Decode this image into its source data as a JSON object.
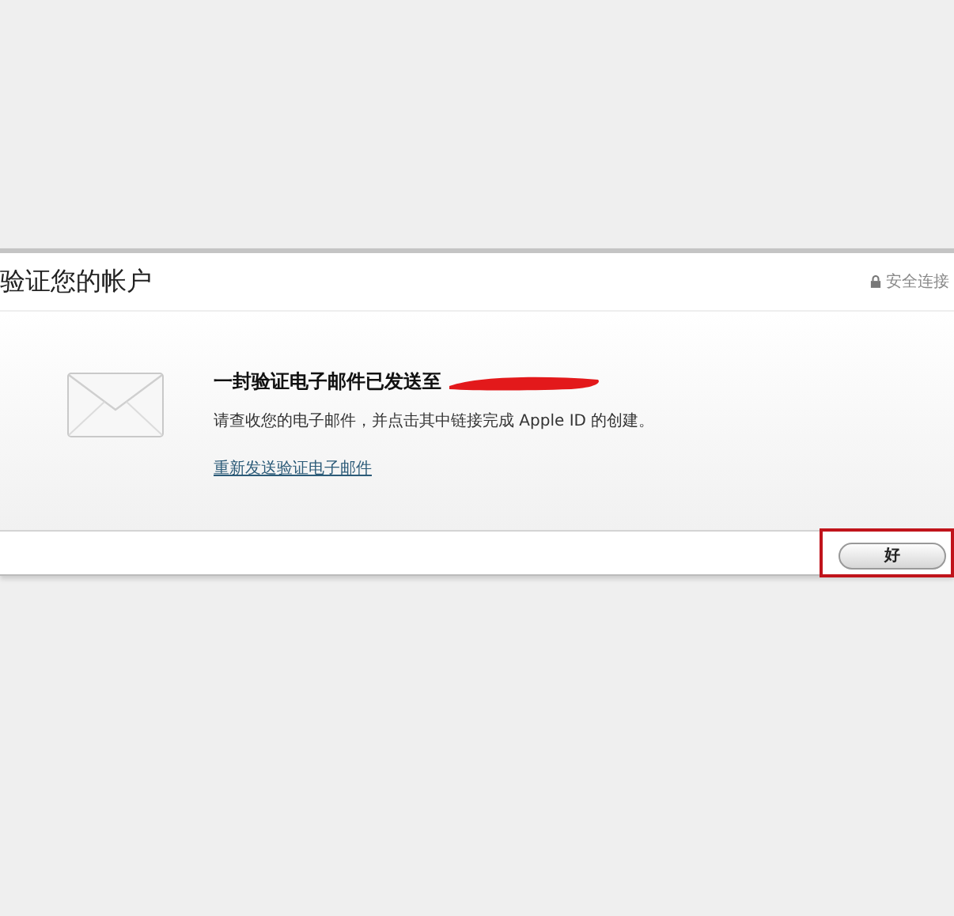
{
  "dialog": {
    "title": "验证您的帐户",
    "secure_label": "安全连接",
    "heading": "一封验证电子邮件已发送至",
    "message": "请查收您的电子邮件，并点击其中链接完成 Apple ID 的创建。",
    "resend_link": "重新发送验证电子邮件",
    "buttons": [
      {
        "label": "好",
        "highlighted": true
      }
    ]
  }
}
